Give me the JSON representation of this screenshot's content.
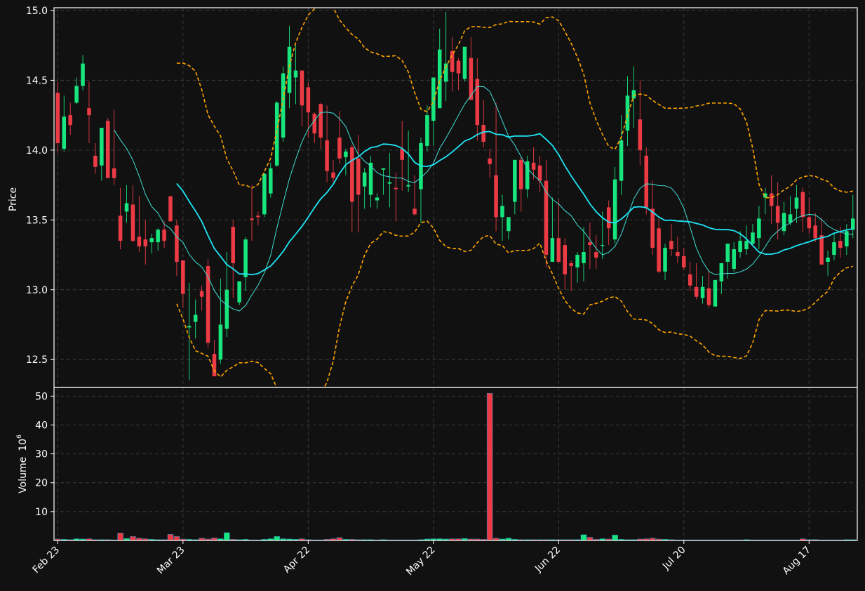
{
  "chart_data": {
    "type": "candlestick",
    "title": "",
    "colors": {
      "background": "#111111",
      "up": "#17E67E",
      "down": "#EC3B45",
      "frame": "#FFFFFF",
      "grid": "#3A3A3A",
      "text": "#FFFFFF",
      "ma_fast": "#3FE0D6",
      "ma_slow": "#1EE5F5",
      "bands": "#FFA500"
    },
    "x_tick_labels": [
      "Feb 23",
      "Mar 23",
      "Apr 22",
      "May 22",
      "Jun 22",
      "Jul 20",
      "Aug 17"
    ],
    "x_tick_index": [
      0,
      20,
      40,
      60,
      80,
      100,
      120
    ],
    "price_panel": {
      "ylabel": "Price",
      "ylim": [
        12.3,
        15.02
      ],
      "yticks": [
        12.5,
        13.0,
        13.5,
        14.0,
        14.5,
        15.0
      ],
      "ytick_labels": [
        "12.5",
        "13.0",
        "13.5",
        "14.0",
        "14.5",
        "15.0"
      ]
    },
    "volume_panel": {
      "ylabel": "Volume",
      "ylabel_exp": "6",
      "ylabel_base": "10",
      "ylim": [
        0,
        53
      ],
      "yticks": [
        10,
        20,
        30,
        40,
        50
      ],
      "ytick_labels": [
        "10",
        "20",
        "30",
        "40",
        "50"
      ]
    },
    "open": [
      14.41,
      14.01,
      14.25,
      14.34,
      14.46,
      14.3,
      13.96,
      13.89,
      14.21,
      13.87,
      13.53,
      13.56,
      13.61,
      13.38,
      13.36,
      13.34,
      13.34,
      13.43,
      13.67,
      13.46,
      13.21,
      12.73,
      12.77,
      12.99,
      13.17,
      12.54,
      12.5,
      12.72,
      13.45,
      12.91,
      13.09,
      13.51,
      13.53,
      13.54,
      13.69,
      13.89,
      14.09,
      14.41,
      14.52,
      14.57,
      14.45,
      14.26,
      14.33,
      14.07,
      13.84,
      14.09,
      13.95,
      14.02,
      13.94,
      13.74,
      13.68,
      13.64,
      13.86,
      13.76,
      13.73,
      14.01,
      13.74,
      13.58,
      13.72,
      14.03,
      14.21,
      14.3,
      14.49,
      14.71,
      14.64,
      14.51,
      14.66,
      14.51,
      14.18,
      13.94,
      13.82,
      13.52,
      13.42,
      13.63,
      13.93,
      13.72,
      13.91,
      13.89,
      13.78,
      13.2,
      13.37,
      13.32,
      13.19,
      13.16,
      13.19,
      13.34,
      13.27,
      13.32,
      13.59,
      13.36,
      13.78,
      14.14,
      14.37,
      14.22,
      13.96,
      13.58,
      13.44,
      13.13,
      13.35,
      13.27,
      13.24,
      13.11,
      13.02,
      12.94,
      13.01,
      12.88,
      13.06,
      13.2,
      13.15,
      13.27,
      13.29,
      13.33,
      13.37,
      13.66,
      13.69,
      13.6,
      13.42,
      13.48,
      13.58,
      13.7,
      13.52,
      13.46,
      13.39,
      13.2,
      13.25,
      13.35,
      13.31,
      13.43
    ],
    "high": [
      14.49,
      14.39,
      14.34,
      14.52,
      14.68,
      14.49,
      14.05,
      13.98,
      14.23,
      14.29,
      13.73,
      13.75,
      13.75,
      13.67,
      13.5,
      13.4,
      13.44,
      13.49,
      13.67,
      13.5,
      13.21,
      13.05,
      12.93,
      13.03,
      13.22,
      12.64,
      13.08,
      13.27,
      13.5,
      13.06,
      13.38,
      13.75,
      13.56,
      13.84,
      13.91,
      14.35,
      14.6,
      14.89,
      14.75,
      14.57,
      14.49,
      14.27,
      14.34,
      14.32,
      13.93,
      14.28,
      14.01,
      14.04,
      14.11,
      13.87,
      13.96,
      13.69,
      13.87,
      13.98,
      13.84,
      14.21,
      14.14,
      13.82,
      14.09,
      14.32,
      14.51,
      14.87,
      14.99,
      14.81,
      14.66,
      14.74,
      14.81,
      14.66,
      14.36,
      14.01,
      14.34,
      13.68,
      13.46,
      13.66,
      13.95,
      13.96,
      14.02,
      13.96,
      13.93,
      13.66,
      13.65,
      13.37,
      13.21,
      13.27,
      13.45,
      13.48,
      13.39,
      13.56,
      13.64,
      13.88,
      14.25,
      14.53,
      14.6,
      14.5,
      14.02,
      13.78,
      13.51,
      13.33,
      13.47,
      13.38,
      13.3,
      13.2,
      13.19,
      13.1,
      13.14,
      13.0,
      13.07,
      13.32,
      13.34,
      13.42,
      13.46,
      13.47,
      13.6,
      13.73,
      13.82,
      13.77,
      13.63,
      13.67,
      13.75,
      13.73,
      13.66,
      13.55,
      13.51,
      13.28,
      13.41,
      13.45,
      13.47,
      13.68
    ],
    "low": [
      13.98,
      13.99,
      14.11,
      14.33,
      14.43,
      14.05,
      13.83,
      13.78,
      13.88,
      13.75,
      13.29,
      13.48,
      13.34,
      13.27,
      13.18,
      13.26,
      13.28,
      13.3,
      13.55,
      13.1,
      12.87,
      12.35,
      12.65,
      12.85,
      12.58,
      12.44,
      12.47,
      12.66,
      12.94,
      12.89,
      12.99,
      13.35,
      13.46,
      13.52,
      13.66,
      13.88,
      14.06,
      14.3,
      14.33,
      14.17,
      14.09,
      14.05,
      14.01,
      13.77,
      13.77,
      13.9,
      13.82,
      13.41,
      13.41,
      13.58,
      13.59,
      13.58,
      13.68,
      13.59,
      13.49,
      13.71,
      13.7,
      13.53,
      13.48,
      13.99,
      14.03,
      14.34,
      14.35,
      14.42,
      14.43,
      14.49,
      14.37,
      14.07,
      14.02,
      13.8,
      13.42,
      13.35,
      13.36,
      13.54,
      13.56,
      13.66,
      13.79,
      13.7,
      13.16,
      13.2,
      13.19,
      13.0,
      12.99,
      13.05,
      13.06,
      13.15,
      13.15,
      13.22,
      13.32,
      13.33,
      13.68,
      14.03,
      14.16,
      13.89,
      13.54,
      13.25,
      13.12,
      13.07,
      13.24,
      13.19,
      13.14,
      12.99,
      12.93,
      12.9,
      12.87,
      12.88,
      12.97,
      13.08,
      13.13,
      13.23,
      13.25,
      13.32,
      13.29,
      13.54,
      13.47,
      13.36,
      13.39,
      13.46,
      13.48,
      13.41,
      13.4,
      13.34,
      13.18,
      13.1,
      13.21,
      13.23,
      13.25,
      13.37
    ],
    "close": [
      14.05,
      14.24,
      14.18,
      14.46,
      14.62,
      14.25,
      13.88,
      14.16,
      13.8,
      13.8,
      13.35,
      13.62,
      13.35,
      13.31,
      13.31,
      13.37,
      13.43,
      13.35,
      13.49,
      13.2,
      12.97,
      12.74,
      12.82,
      12.95,
      12.62,
      12.38,
      12.75,
      13.0,
      13.19,
      13.06,
      13.36,
      13.5,
      13.52,
      13.83,
      13.87,
      14.34,
      14.55,
      14.74,
      14.57,
      14.32,
      14.27,
      14.12,
      14.09,
      13.85,
      13.8,
      13.94,
      13.99,
      13.63,
      13.68,
      13.84,
      13.91,
      13.66,
      13.87,
      13.77,
      13.72,
      13.93,
      13.75,
      13.54,
      14.05,
      14.25,
      14.52,
      14.72,
      14.62,
      14.56,
      14.55,
      14.74,
      14.36,
      14.18,
      14.06,
      13.9,
      13.52,
      13.6,
      13.52,
      13.93,
      13.72,
      13.92,
      13.86,
      13.78,
      13.25,
      13.37,
      13.2,
      13.11,
      13.17,
      13.25,
      13.27,
      13.32,
      13.23,
      13.32,
      13.44,
      13.79,
      14.07,
      14.39,
      14.43,
      14.0,
      13.59,
      13.3,
      13.13,
      13.3,
      13.29,
      13.24,
      13.16,
      13.03,
      12.95,
      13.02,
      12.89,
      13.07,
      13.19,
      13.33,
      13.29,
      13.35,
      13.35,
      13.41,
      13.51,
      13.69,
      13.6,
      13.48,
      13.55,
      13.54,
      13.66,
      13.52,
      13.44,
      13.37,
      13.18,
      13.23,
      13.34,
      13.3,
      13.42,
      13.51
    ],
    "volume": [
      0.5,
      0.4,
      0.3,
      0.6,
      0.5,
      0.6,
      0.3,
      0.3,
      0.3,
      0.2,
      2.6,
      0.7,
      1.4,
      0.8,
      0.6,
      0.4,
      0.3,
      0.3,
      2.1,
      1.4,
      0.5,
      0.4,
      0.3,
      0.8,
      0.5,
      0.9,
      0.6,
      2.7,
      0.4,
      0.3,
      0.4,
      0.2,
      0.2,
      0.4,
      0.6,
      1.4,
      0.6,
      0.5,
      0.4,
      0.6,
      0.3,
      0.2,
      0.2,
      0.4,
      0.6,
      1.0,
      0.4,
      0.4,
      0.3,
      0.3,
      0.3,
      0.2,
      0.3,
      0.2,
      0.2,
      0.2,
      0.2,
      0.2,
      0.3,
      0.5,
      0.6,
      0.6,
      0.5,
      0.6,
      0.6,
      0.7,
      0.5,
      0.5,
      0.4,
      51.0,
      0.8,
      0.5,
      0.8,
      0.4,
      0.3,
      0.3,
      0.3,
      0.3,
      0.3,
      0.3,
      0.3,
      0.3,
      0.3,
      0.3,
      2.0,
      1.1,
      0.4,
      0.6,
      0.5,
      1.9,
      0.4,
      0.3,
      0.3,
      0.5,
      0.6,
      0.8,
      0.5,
      0.4,
      0.3,
      0.2,
      0.2,
      0.2,
      0.2,
      0.2,
      0.2,
      0.2,
      0.2,
      0.2,
      0.2,
      0.2,
      0.3,
      0.2,
      0.2,
      0.2,
      0.2,
      0.2,
      0.2,
      0.2,
      0.2,
      0.6,
      0.3,
      0.3,
      0.2,
      0.2,
      0.2,
      0.2,
      0.3,
      0.3
    ],
    "ma_fast_window": 10,
    "ma_slow_window": 20,
    "band_window": 20,
    "band_k": 2
  }
}
